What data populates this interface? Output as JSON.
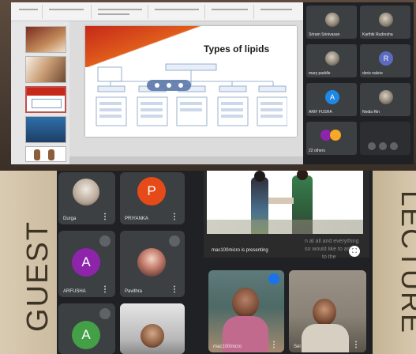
{
  "slide": {
    "title": "Types of lipids"
  },
  "laptop_participants": [
    {
      "name": "Sriram Srinivasan",
      "initial": "",
      "color": "#5f6368"
    },
    {
      "name": "Karthik Rudresha",
      "initial": "",
      "color": "#5f6368"
    },
    {
      "name": "mary paddle",
      "initial": "",
      "color": "#5f6368"
    },
    {
      "name": "deris nakrie",
      "initial": "R",
      "color": "#5c6bc0"
    },
    {
      "name": "ARIF FUSHA",
      "initial": "A",
      "color": "#1e88e5"
    },
    {
      "name": "Nedia Rin",
      "initial": "",
      "color": "#5f6368"
    },
    {
      "name": "22 others",
      "initial": "",
      "color": "#5f6368"
    },
    {
      "name": "",
      "initial": "",
      "color": "#5f6368"
    }
  ],
  "phone_participants": [
    {
      "name": "Durga",
      "initial": "",
      "color": "#cfd8dc"
    },
    {
      "name": "PRIYANKA",
      "initial": "P",
      "color": "#e64a19"
    },
    {
      "name": "ARFUSHA",
      "initial": "A",
      "color": "#8e24aa"
    },
    {
      "name": "Pavithra",
      "initial": "",
      "color": "#cfd8dc"
    },
    {
      "name": "",
      "initial": "A",
      "color": "#43a047"
    },
    {
      "name": "",
      "initial": "",
      "color": "#cfd8dc"
    }
  ],
  "presentation": {
    "label": "mac100micro is presenting",
    "overlay_1": "n at all and everything",
    "overlay_2": "so would like to ask",
    "overlay_3": "to the"
  },
  "self_tiles": [
    {
      "name": "mac100micro"
    },
    {
      "name": "Sel"
    }
  ],
  "side_labels": {
    "left": "GUEST",
    "right": "LECTURE"
  },
  "colors": {
    "meet_bg": "#202124",
    "tile_bg": "#3c4043",
    "slide_accent": "#c6281a"
  }
}
